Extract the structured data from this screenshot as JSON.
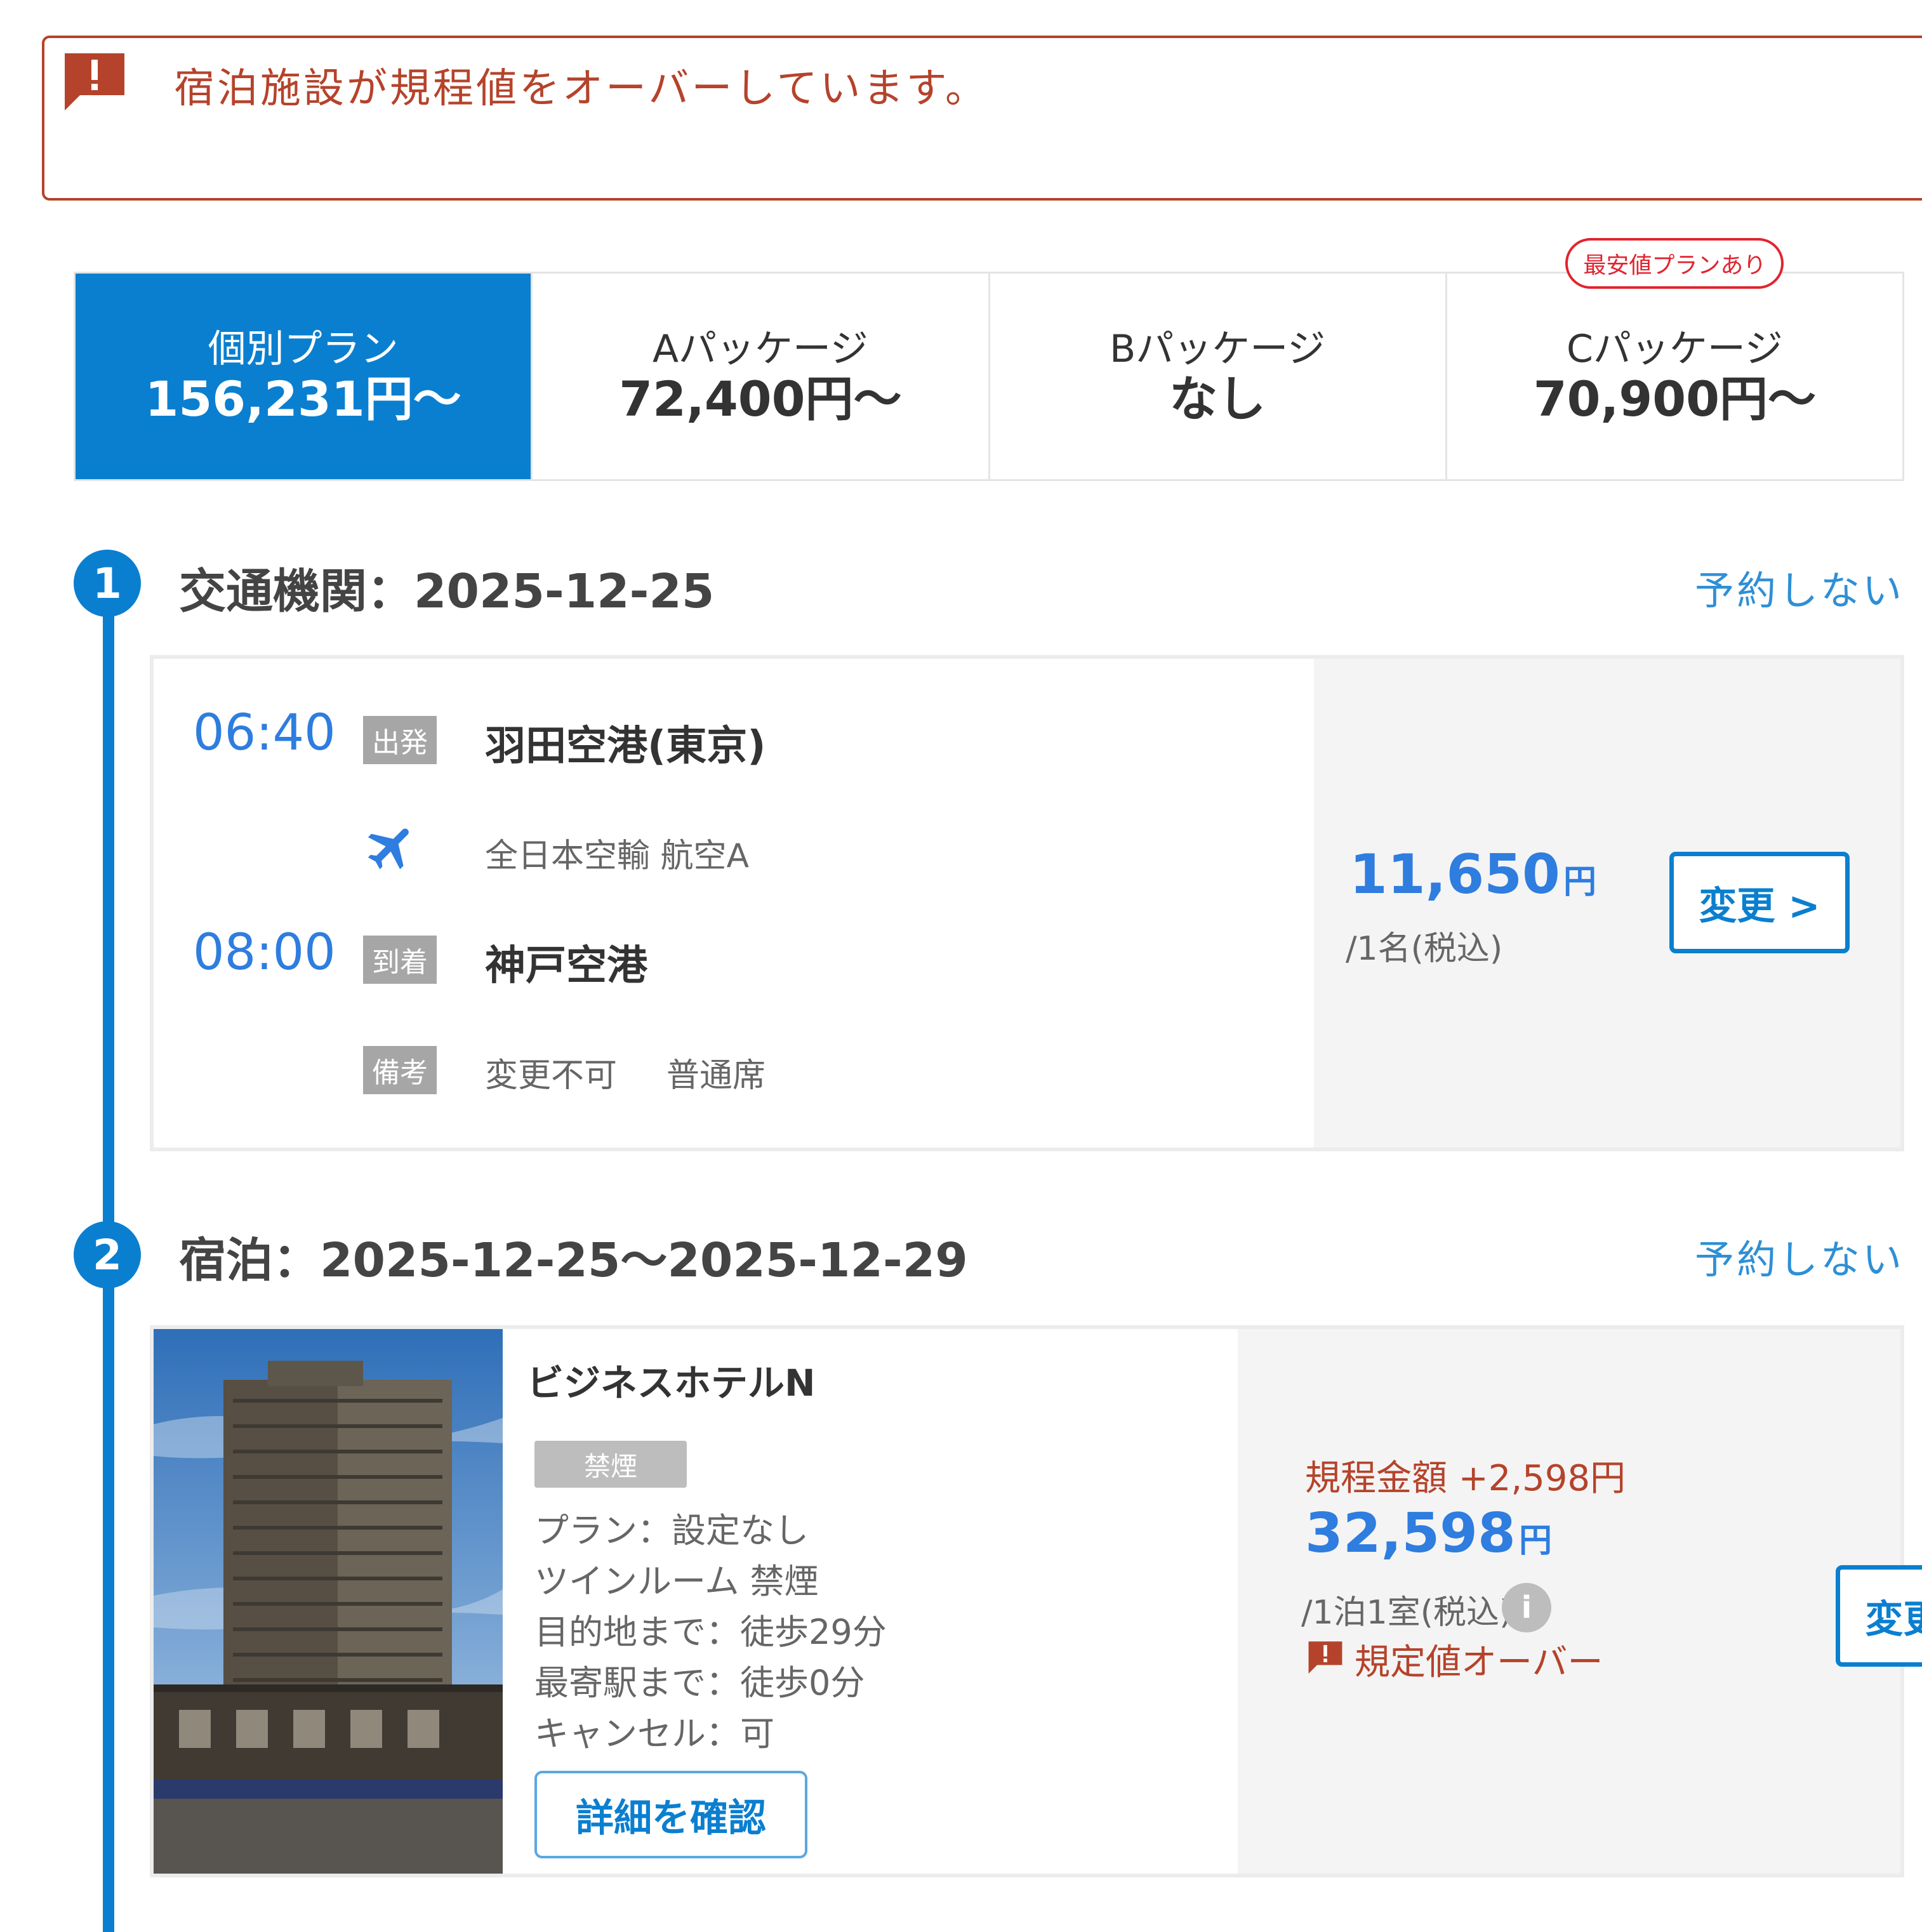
{
  "alert": {
    "icon": "alert-icon",
    "message": "宿泊施設が規程値をオーバーしています。",
    "color": "#b5432b"
  },
  "tabs": [
    {
      "name": "個別プラン",
      "price": "156,231円〜",
      "active": true,
      "badge": ""
    },
    {
      "name": "Aパッケージ",
      "price": "72,400円〜",
      "active": false,
      "badge": ""
    },
    {
      "name": "Bパッケージ",
      "price": "なし",
      "active": false,
      "badge": ""
    },
    {
      "name": "Cパッケージ",
      "price": "70,900円〜",
      "active": false,
      "badge": "最安値プランあり"
    }
  ],
  "sections": {
    "transport": {
      "step": "1",
      "title": "交通機関：2025-12-25",
      "skip": "予約しない",
      "departure": {
        "time": "06:40",
        "tag": "出発",
        "place": "羽田空港(東京)"
      },
      "carrier": {
        "icon": "airplane-icon",
        "text": "全日本空輸 航空A"
      },
      "arrival": {
        "time": "08:00",
        "tag": "到着",
        "place": "神戸空港"
      },
      "remarks": {
        "tag": "備考",
        "items": [
          "変更不可",
          "普通席"
        ]
      },
      "price": {
        "amount": "11,650",
        "unit": "円",
        "note": "/1名(税込)"
      },
      "change_label": "変更 >"
    },
    "hotel": {
      "step": "2",
      "title": "宿泊：2025-12-25〜2025-12-29",
      "skip": "予約しない",
      "name": "ビジネスホテルN",
      "badge": "禁煙",
      "lines": [
        "プラン：設定なし",
        "ツインルーム 禁煙",
        "目的地まで：徒歩29分",
        "最寄駅まで：徒歩0分",
        "キャンセル：可"
      ],
      "detail_label": "詳細を確認",
      "policy_diff": "規程金額 +2,598円",
      "price": {
        "amount": "32,598",
        "unit": "円",
        "note": "/1泊1室(税込)"
      },
      "info_icon": "info-icon",
      "over_label": "規定値オーバー",
      "change_label": "変更 >"
    }
  },
  "colors": {
    "primary": "#0a7fd0",
    "price": "#2e7ddf",
    "warning": "#b5432b",
    "badge_red": "#e0242f"
  }
}
